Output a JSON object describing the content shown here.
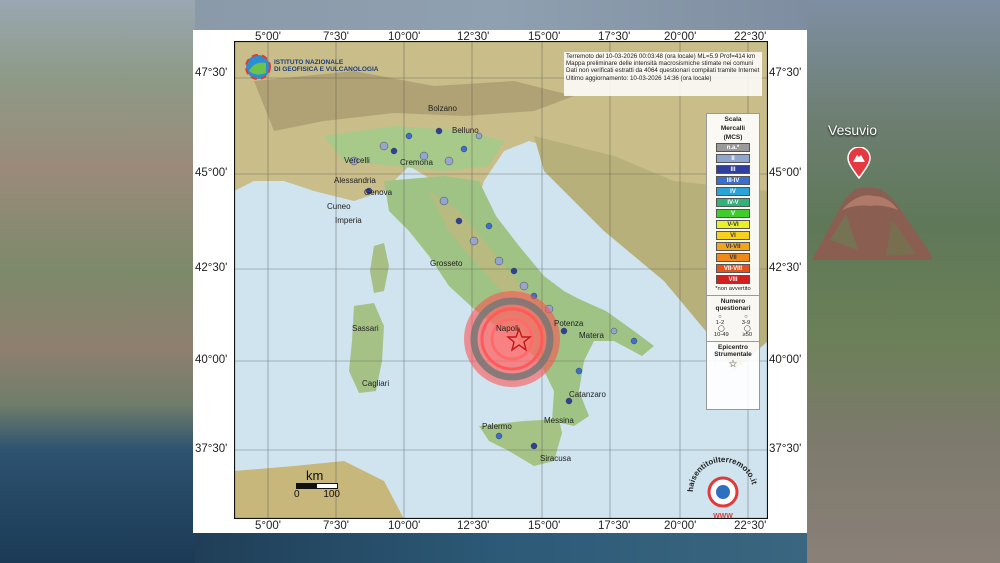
{
  "video_overlay": {
    "landmark_label": "Vesuvio",
    "landmark_icon": "volcano-pin-icon"
  },
  "map": {
    "institute": {
      "line1": "ISTITUTO NAZIONALE",
      "line2": "DI GEOFISICA E VULCANOLOGIA"
    },
    "info": {
      "line1": "Terremoto del 10-03-2026 00:03:48 (ora locale) ML=5.9 Prof=414 km",
      "line2": "Mappa preliminare delle intensità macrosismiche stimate nei comuni",
      "line3": "Dati non verificati estratti da 4064 questionari compilati tramite Internet",
      "line4": "Ultimo aggiornamento: 10-03-2026 14:36 (ora locale)"
    },
    "lon_ticks": [
      "5°00'",
      "7°30'",
      "10°00'",
      "12°30'",
      "15°00'",
      "17°30'",
      "20°00'",
      "22°30'"
    ],
    "lat_ticks": [
      "47°30'",
      "45°00'",
      "42°30'",
      "40°00'",
      "37°30'"
    ],
    "scale_bar": {
      "unit": "km",
      "start": "0",
      "end": "100"
    },
    "cities": [
      "Bolzano",
      "Belluno",
      "Vercelli",
      "Cremona",
      "Alessandria",
      "Genova",
      "Cuneo",
      "Imperia",
      "Grosseto",
      "Napoli",
      "Matera",
      "Potenza",
      "Sassari",
      "Cagliari",
      "Palermo",
      "Messina",
      "Siracusa",
      "Catanzaro"
    ],
    "epicenter": "epicenter-star-icon",
    "legend": {
      "title1": "Scala",
      "title2": "Mercalli",
      "title3": "(MCS)",
      "classes": [
        {
          "label": "n.a.*",
          "color": "#9a9a9a",
          "text": "#ffffff"
        },
        {
          "label": "II",
          "color": "#8fa6cf",
          "text": "#ffffff"
        },
        {
          "label": "III",
          "color": "#2e3f9e",
          "text": "#ffffff"
        },
        {
          "label": "III-IV",
          "color": "#3a6fd0",
          "text": "#ffffff"
        },
        {
          "label": "IV",
          "color": "#29a3d8",
          "text": "#ffffff"
        },
        {
          "label": "IV-V",
          "color": "#30b37a",
          "text": "#ffffff"
        },
        {
          "label": "V",
          "color": "#3fcd2e",
          "text": "#ffffff"
        },
        {
          "label": "V-VI",
          "color": "#e8f02a",
          "text": "#333333"
        },
        {
          "label": "VI",
          "color": "#f6d21f",
          "text": "#333333"
        },
        {
          "label": "VI-VII",
          "color": "#f2a51c",
          "text": "#333333"
        },
        {
          "label": "VII",
          "color": "#ee8a1a",
          "text": "#333333"
        },
        {
          "label": "VII-VIII",
          "color": "#e5531a",
          "text": "#ffffff"
        },
        {
          "label": "VIII",
          "color": "#d41f1f",
          "text": "#ffffff"
        }
      ],
      "note": "*non avvertito",
      "quest_title1": "Numero",
      "quest_title2": "questionari",
      "quest_a": "1-2",
      "quest_b": "3-9",
      "quest_c": "10-49",
      "quest_d": "≥50",
      "epi_title1": "Epicentro",
      "epi_title2": "Strumentale"
    },
    "watermark": {
      "text": "haisentitoilterremoto.it",
      "sub": "WWW"
    }
  }
}
